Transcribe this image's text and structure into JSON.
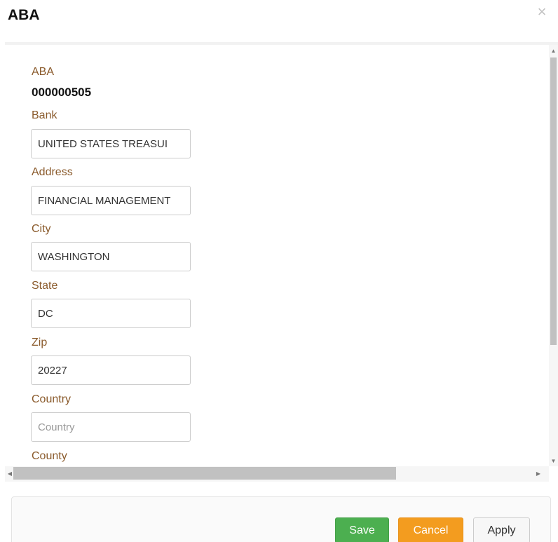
{
  "dialog": {
    "title": "ABA",
    "close_glyph": "×"
  },
  "form": {
    "aba_label": "ABA",
    "aba_value": "000000505",
    "bank_label": "Bank",
    "bank_value": "UNITED STATES TREASUI",
    "address_label": "Address",
    "address_value": "FINANCIAL MANAGEMENT",
    "city_label": "City",
    "city_value": "WASHINGTON",
    "state_label": "State",
    "state_value": "DC",
    "zip_label": "Zip",
    "zip_value": "20227",
    "country_label": "Country",
    "country_placeholder": "Country",
    "county_label": "County"
  },
  "scrollbars": {
    "up_glyph": "▲",
    "down_glyph": "▼",
    "left_glyph": "◀",
    "right_glyph": "▶"
  },
  "footer": {
    "save_label": "Save",
    "cancel_label": "Cancel",
    "apply_label": "Apply"
  },
  "colors": {
    "label": "#8a5a2b",
    "save": "#4caf50",
    "cancel": "#f39c1f",
    "apply": "#f7f7f7"
  }
}
